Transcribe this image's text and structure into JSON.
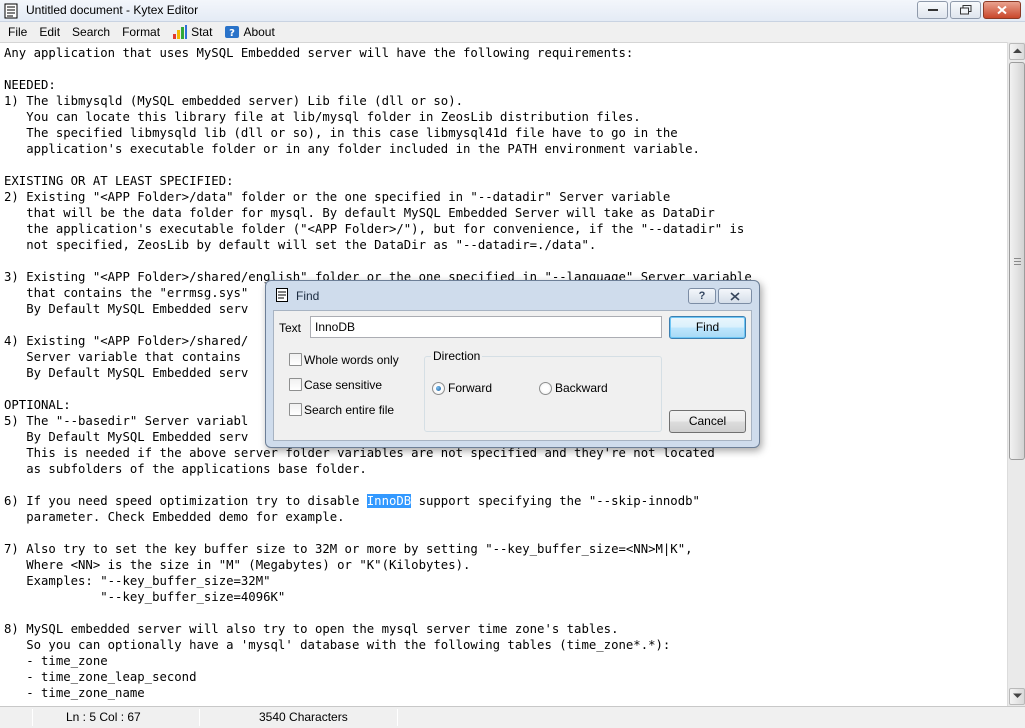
{
  "window": {
    "title": "Untitled document - Kytex Editor"
  },
  "menu": {
    "file": "File",
    "edit": "Edit",
    "search": "Search",
    "format": "Format",
    "stat": "Stat",
    "about": "About"
  },
  "editor": {
    "before_selection": "Any application that uses MySQL Embedded server will have the following requirements:\n\nNEEDED:\n1) The libmysqld (MySQL embedded server) Lib file (dll or so).\n   You can locate this library file at lib/mysql folder in ZeosLib distribution files.\n   The specified libmysqld lib (dll or so), in this case libmysql41d file have to go in the\n   application's executable folder or in any folder included in the PATH environment variable.\n\nEXISTING OR AT LEAST SPECIFIED:\n2) Existing \"<APP Folder>/data\" folder or the one specified in \"--datadir\" Server variable\n   that will be the data folder for mysql. By default MySQL Embedded Server will take as DataDir\n   the application's executable folder (\"<APP Folder>/\"), but for convenience, if the \"--datadir\" is\n   not specified, ZeosLib by default will set the DataDir as \"--datadir=./data\".\n\n3) Existing \"<APP Folder>/shared/english\" folder or the one specified in \"--language\" Server variable\n   that contains the \"errmsg.sys\"\n   By Default MySQL Embedded serv\n\n4) Existing \"<APP Folder>/shared/                                                    \"\n   Server variable that contains\n   By Default MySQL Embedded serv\n\nOPTIONAL:\n5) The \"--basedir\" Server variabl\n   By Default MySQL Embedded serv                                                  er (\"./\")\n   This is needed if the above server folder variables are not specified and they're not located\n   as subfolders of the applications base folder.\n\n6) If you need speed optimization try to disable ",
    "selected": "InnoDB",
    "after_selection": " support specifying the \"--skip-innodb\"\n   parameter. Check Embedded demo for example.\n\n7) Also try to set the key buffer size to 32M or more by setting \"--key_buffer_size=<NN>M|K\",\n   Where <NN> is the size in \"M\" (Megabytes) or \"K\"(Kilobytes).\n   Examples: \"--key_buffer_size=32M\"\n             \"--key_buffer_size=4096K\"\n\n8) MySQL embedded server will also try to open the mysql server time zone's tables.\n   So you can optionally have a 'mysql' database with the following tables (time_zone*.*):\n   - time_zone\n   - time_zone_leap_second\n   - time_zone_name"
  },
  "find_dialog": {
    "title": "Find",
    "help": "?",
    "text_label": "Text",
    "text_value": "InnoDB",
    "find_button": "Find",
    "cancel_button": "Cancel",
    "whole_words": "Whole words only",
    "case_sensitive": "Case sensitive",
    "search_entire": "Search entire file",
    "direction_label": "Direction",
    "forward": "Forward",
    "backward": "Backward"
  },
  "status": {
    "position": "Ln : 5 Col : 67",
    "characters": "3540 Characters"
  },
  "colors": {
    "selection": "#3399ff",
    "dialog_frame": "#cfdcec"
  },
  "icons": [
    "document-icon",
    "minimize-icon",
    "maximize-icon",
    "close-icon",
    "bar-chart-icon",
    "help-icon",
    "scroll-up-icon",
    "scroll-down-icon"
  ]
}
